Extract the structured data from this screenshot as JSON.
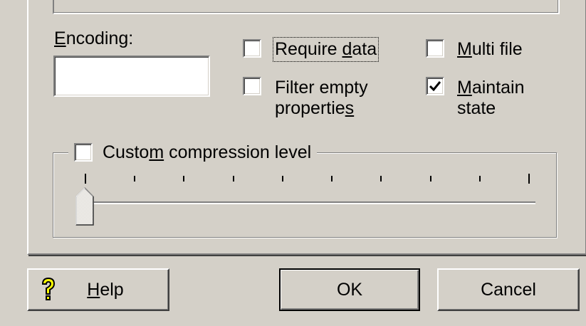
{
  "encoding": {
    "label_underline": "E",
    "label_rest": "ncoding:",
    "value": ""
  },
  "options": {
    "require_data": {
      "label_pre": "Require ",
      "label_underline": "d",
      "label_post": "ata",
      "checked": false
    },
    "filter_empty": {
      "line1": "Filter empty",
      "line2_pre": "propertie",
      "line2_underline": "s",
      "checked": false
    },
    "multi_file": {
      "label_underline": "M",
      "label_post": "ulti file",
      "checked": false
    },
    "maintain_state": {
      "line1_underline": "M",
      "line1_post": "aintain",
      "line2": "state",
      "checked": true
    }
  },
  "compression": {
    "label_pre": "Custo",
    "label_underline": "m",
    "label_post": " compression level",
    "enabled": false,
    "level": 0,
    "tick_count": 10
  },
  "buttons": {
    "help": {
      "icon": "question-mark-icon",
      "underline": "H",
      "rest": "elp"
    },
    "ok": {
      "label": "OK"
    },
    "cancel": {
      "label": "Cancel"
    }
  }
}
